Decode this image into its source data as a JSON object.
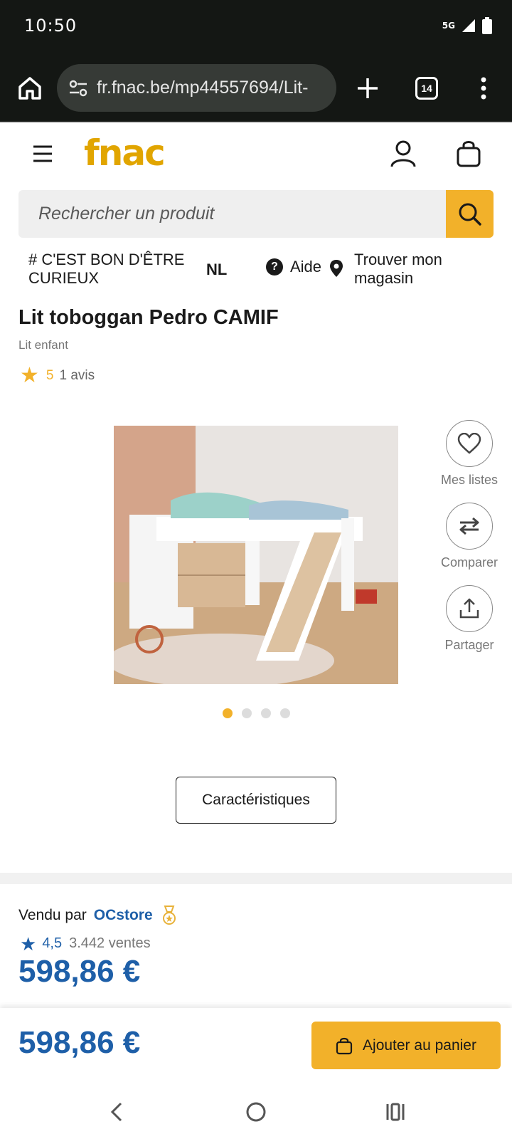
{
  "status_bar": {
    "time": "10:50",
    "network": "5G"
  },
  "browser": {
    "url": "fr.fnac.be/mp44557694/Lit-",
    "tab_count": "14"
  },
  "header": {
    "logo": "fnac",
    "search_placeholder": "Rechercher un produit"
  },
  "nav": {
    "slogan": "# C'EST BON D'ÊTRE CURIEUX",
    "language": "NL",
    "help": "Aide",
    "store": "Trouver mon magasin"
  },
  "product": {
    "title": "Lit toboggan Pedro CAMIF",
    "category": "Lit enfant",
    "rating": "5",
    "reviews": "1 avis",
    "image_count": 4,
    "active_image": 0
  },
  "actions": {
    "lists": "Mes listes",
    "compare": "Comparer",
    "share": "Partager",
    "characteristics": "Caractéristiques"
  },
  "seller": {
    "sold_by": "Vendu par",
    "name": "OCstore",
    "rating": "4,5",
    "sales": "3.442 ventes",
    "price": "598,86 €"
  },
  "sticky": {
    "price": "598,86 €",
    "add_to_cart": "Ajouter au panier"
  },
  "colors": {
    "fnac_yellow": "#f2b12a",
    "price_blue": "#1e5fa8",
    "chrome_dark": "#141714"
  }
}
